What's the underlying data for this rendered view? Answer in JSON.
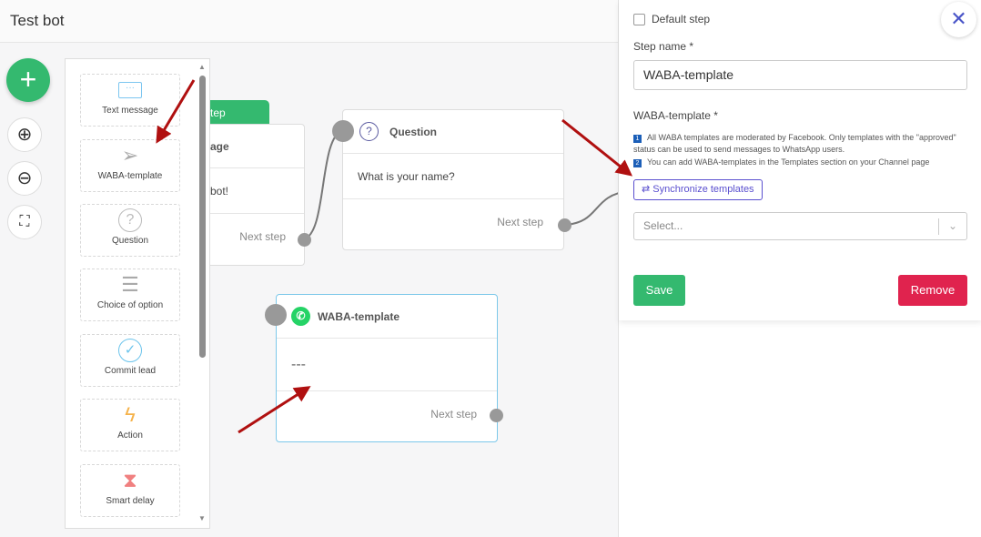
{
  "header": {
    "title": "Test bot"
  },
  "toolbar": {
    "add": "+",
    "zoom_in": "⊕",
    "zoom_out": "⊖",
    "fit": "⛶"
  },
  "palette": {
    "items": [
      {
        "label": "Text message",
        "icon": "chat-bubble-icon"
      },
      {
        "label": "WABA-template",
        "icon": "paper-plane-icon"
      },
      {
        "label": "Question",
        "icon": "question-circle-icon"
      },
      {
        "label": "Choice of option",
        "icon": "list-icon"
      },
      {
        "label": "Commit lead",
        "icon": "check-circle-icon"
      },
      {
        "label": "Action",
        "icon": "lightning-icon"
      },
      {
        "label": "Smart delay",
        "icon": "hourglass-icon"
      }
    ]
  },
  "nodes": {
    "start": {
      "tag": "tep",
      "title": "age",
      "body": "bot!",
      "next": "Next step"
    },
    "question": {
      "title": "Question",
      "body": "What is your name?",
      "next": "Next step"
    },
    "waba": {
      "title": "WABA-template",
      "body": "---",
      "next": "Next step"
    }
  },
  "panel": {
    "default_step": "Default step",
    "step_name_label": "Step name *",
    "step_name_value": "WABA-template",
    "waba_label": "WABA-template *",
    "note1": "All WABA templates are moderated by Facebook. Only templates with the \"approved\" status can be used to send messages to WhatsApp users.",
    "note2": "You can add WABA-templates in the Templates section on your Channel page",
    "sync": "Synchronize templates",
    "select_placeholder": "Select...",
    "save": "Save",
    "remove": "Remove"
  },
  "colors": {
    "green": "#34b96f",
    "red": "#e0234e",
    "accent": "#5a4fcf",
    "arrow": "#b01010"
  }
}
